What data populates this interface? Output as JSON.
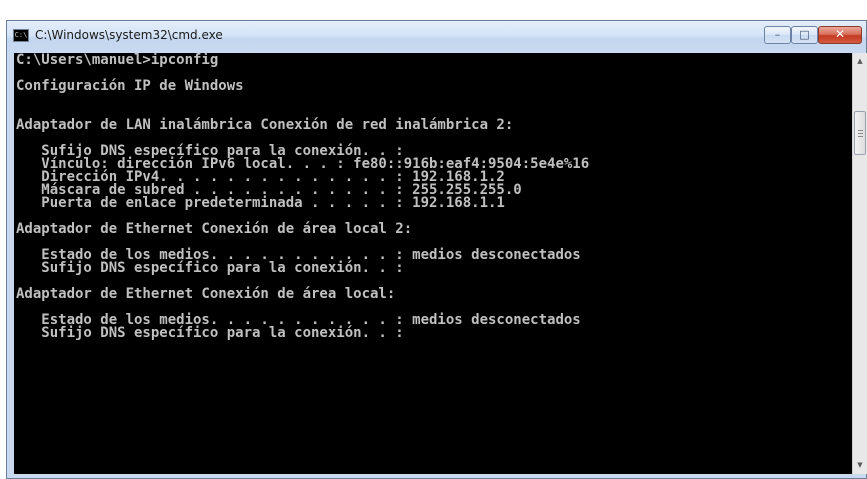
{
  "window": {
    "title": "C:\\Windows\\system32\\cmd.exe",
    "icon_name": "cmd-icon",
    "icon_glyph": "C:\\",
    "controls": {
      "minimize_glyph": "–",
      "maximize_glyph": "□",
      "close_glyph": "✕"
    }
  },
  "console": {
    "background": "#000000",
    "foreground": "#c0c0c0",
    "lines": [
      "C:\\Users\\manuel>ipconfig",
      "",
      "Configuración IP de Windows",
      "",
      "",
      "Adaptador de LAN inalámbrica Conexión de red inalámbrica 2:",
      "",
      "   Sufijo DNS específico para la conexión. . :",
      "   Vínculo: dirección IPv6 local. . . : fe80::916b:eaf4:9504:5e4e%16",
      "   Dirección IPv4. . . . . . . . . . . . . . : 192.168.1.2",
      "   Máscara de subred . . . . . . . . . . . . : 255.255.255.0",
      "   Puerta de enlace predeterminada . . . . . : 192.168.1.1",
      "",
      "Adaptador de Ethernet Conexión de área local 2:",
      "",
      "   Estado de los medios. . . . . . . . . . . : medios desconectados",
      "   Sufijo DNS específico para la conexión. . :",
      "",
      "Adaptador de Ethernet Conexión de área local:",
      "",
      "   Estado de los medios. . . . . . . . . . . : medios desconectados",
      "   Sufijo DNS específico para la conexión. . :"
    ]
  },
  "scrollbar": {
    "up_glyph": "▲",
    "down_glyph": "▼",
    "position": 0.12
  }
}
